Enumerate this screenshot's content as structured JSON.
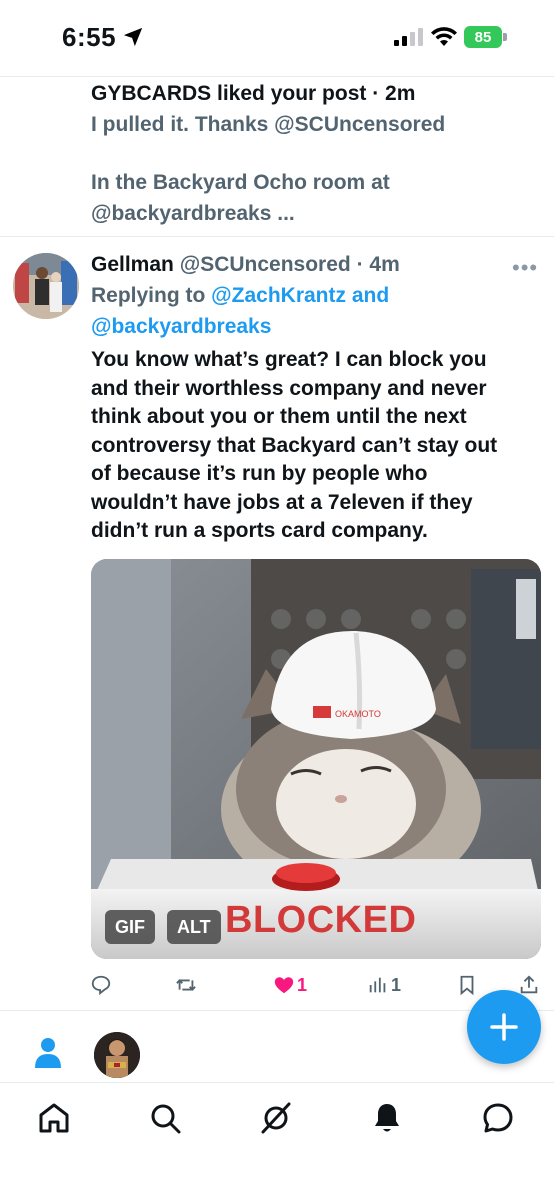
{
  "status_bar": {
    "time": "6:55",
    "battery": "85"
  },
  "notification": {
    "line1": "GYBCARDS liked your post · 2m",
    "line2": "I pulled it.   Thanks @SCUncensored",
    "line3": "In the Backyard Ocho room at",
    "line4": "@backyardbreaks    ..."
  },
  "tweet": {
    "name": "Gellman",
    "handle_time": "@SCUncensored · 4m",
    "replying_prefix": "Replying to ",
    "replying_user1": "@ZachKrantz",
    "replying_and": " and",
    "replying_user2": "@backyardbreaks",
    "text_lines": [
      "You know what’s great? I can block you",
      "and their worthless company and never",
      "think about you or them until the next",
      "controversy that Backyard can’t stay out",
      "of because it’s run by people who",
      "wouldn’t have jobs at a 7eleven if they",
      "didn’t run a sports card company."
    ],
    "media": {
      "gif_badge": "GIF",
      "alt_badge": "ALT",
      "overlay_text": "BLOCKED",
      "helmet_text": "OKAMOTO"
    },
    "likes": "1",
    "views": "1"
  },
  "colors": {
    "accent": "#1d9bf0",
    "like": "#f91880",
    "muted": "#536471"
  }
}
